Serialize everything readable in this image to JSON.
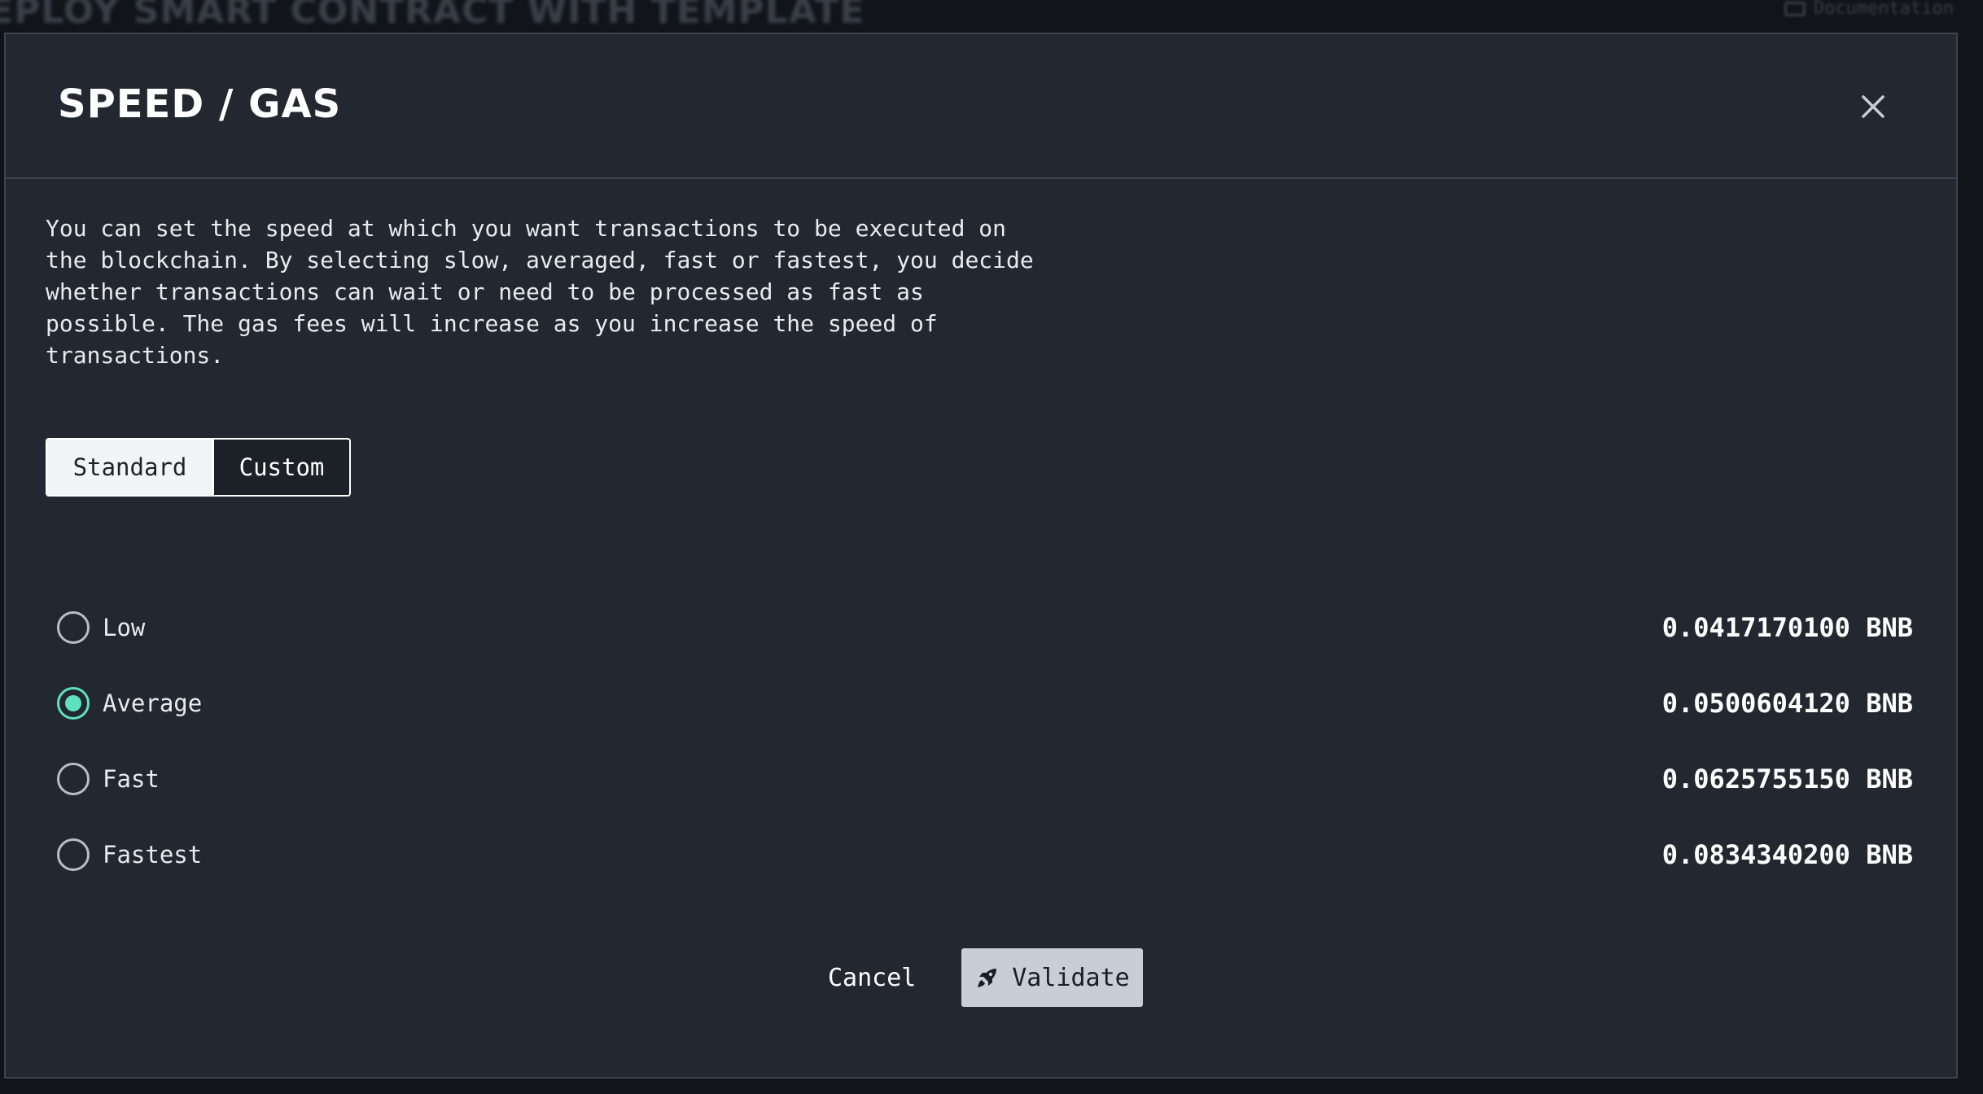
{
  "background": {
    "page_title": "EPLOY SMART CONTRACT WITH TEMPLATE",
    "documentation_link": "Documentation"
  },
  "modal": {
    "title": "SPEED / GAS",
    "close_icon": "close-icon",
    "description": "You can set the speed at which you want transactions to be executed on the blockchain. By selecting slow, averaged, fast or fastest, you decide whether transactions can wait or need to be processed as fast as possible. The gas fees will increase as you increase the speed of transactions.",
    "tabs": [
      {
        "label": "Standard",
        "active": true
      },
      {
        "label": "Custom",
        "active": false
      }
    ],
    "options": [
      {
        "label": "Low",
        "fee": "0.0417170100 BNB",
        "selected": false
      },
      {
        "label": "Average",
        "fee": "0.0500604120 BNB",
        "selected": true
      },
      {
        "label": "Fast",
        "fee": "0.0625755150 BNB",
        "selected": false
      },
      {
        "label": "Fastest",
        "fee": "0.0834340200 BNB",
        "selected": false
      }
    ],
    "cancel_label": "Cancel",
    "validate_label": "Validate",
    "validate_icon": "rocket-icon"
  },
  "colors": {
    "modal_bg": "#232830",
    "accent": "#5ee1c0",
    "validate_bg": "#c8ced6"
  }
}
